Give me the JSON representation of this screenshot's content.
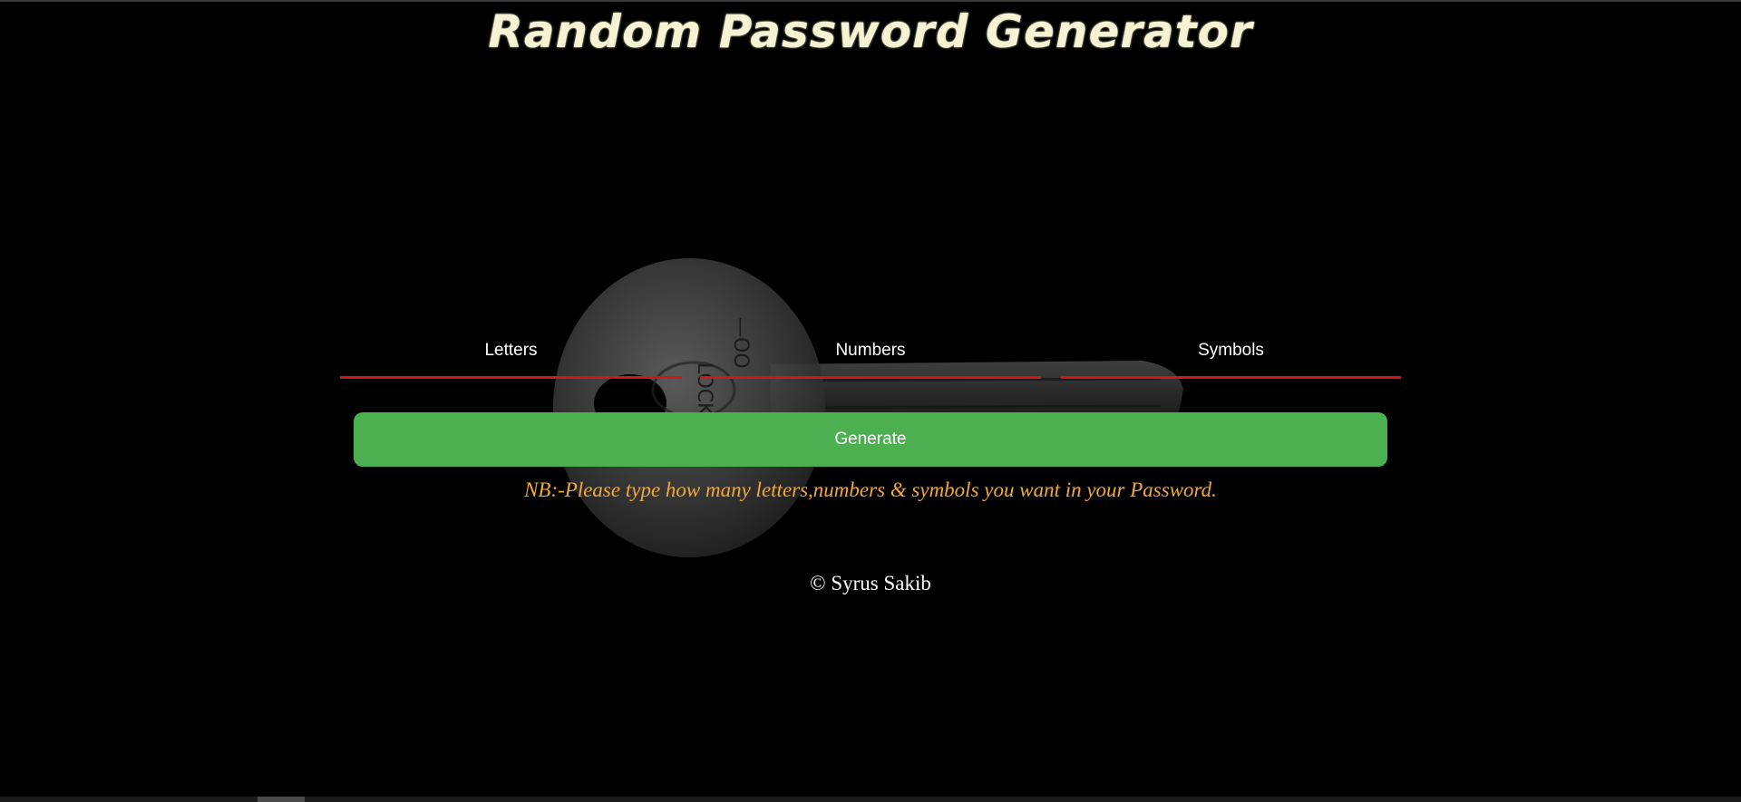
{
  "header": {
    "title": "Random Password Generator"
  },
  "form": {
    "fields": [
      {
        "label": "Letters",
        "value": "",
        "placeholder": ""
      },
      {
        "label": "Numbers",
        "value": "",
        "placeholder": ""
      },
      {
        "label": "Symbols",
        "value": "",
        "placeholder": ""
      }
    ],
    "generate_label": "Generate",
    "note": "NB:-Please type how many letters,numbers & symbols you want in your Password."
  },
  "footer": {
    "copyright": "© Syrus Sakib"
  },
  "colors": {
    "background": "#000000",
    "title": "#f6f3d4",
    "underline": "#d01818",
    "button": "#4caf50",
    "note": "#f2a93b"
  },
  "icons": {
    "background_image": "key-image"
  }
}
